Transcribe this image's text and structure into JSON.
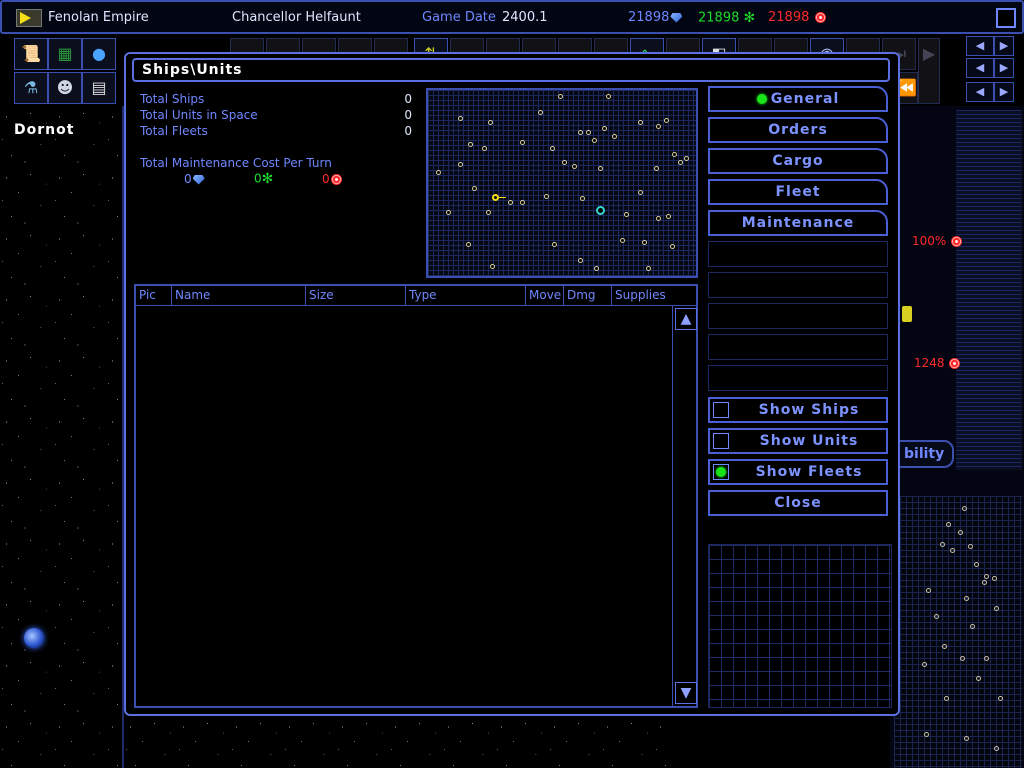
{
  "topbar": {
    "empire": "Fenolan Empire",
    "leader": "Chancellor Helfaunt",
    "date_label": "Game Date",
    "date_value": "2400.1",
    "resources": [
      {
        "value": "21898",
        "color": "#6f87ff",
        "icon": "minerals-icon"
      },
      {
        "value": "21898",
        "color": "#1fdc2a",
        "icon": "organics-icon"
      },
      {
        "value": "21898",
        "color": "#ff2a2a",
        "icon": "radioactives-icon"
      }
    ]
  },
  "background": {
    "planet_name": "Dornot",
    "percent": "100%",
    "value": "1248",
    "ability_label": "bility"
  },
  "dialog": {
    "title": "Ships\\Units",
    "stats": [
      {
        "label": "Total Ships",
        "value": "0"
      },
      {
        "label": "Total Units in Space",
        "value": "0"
      },
      {
        "label": "Total Fleets",
        "value": "0"
      }
    ],
    "maintenance_label": "Total Maintenance Cost Per Turn",
    "maintenance": {
      "minerals": "0",
      "organics": "0",
      "radioactives": "0"
    },
    "columns": [
      "Pic",
      "Name",
      "Size",
      "Type",
      "Move",
      "Dmg",
      "Supplies"
    ],
    "tabs": [
      "General",
      "Orders",
      "Cargo",
      "Fleet",
      "Maintenance"
    ],
    "active_tab": "General",
    "checkboxes": [
      {
        "label": "Show Ships",
        "checked": false
      },
      {
        "label": "Show Units",
        "checked": false
      },
      {
        "label": "Show Fleets",
        "checked": true
      }
    ],
    "close_label": "Close"
  },
  "icons": {
    "toolbar": [
      "scroll-icon",
      "circuit-icon",
      "planet-icon",
      "flask-icon",
      "alien-icon",
      "document-icon"
    ],
    "scroll_up": "arrow-up-icon",
    "scroll_down": "arrow-down-icon"
  }
}
